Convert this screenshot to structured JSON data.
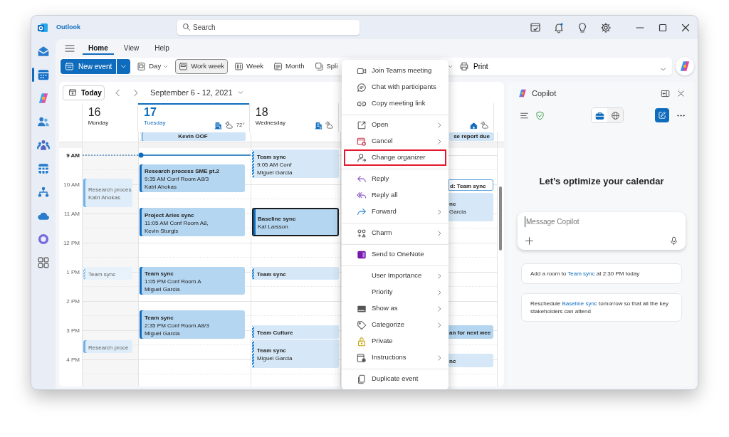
{
  "window": {
    "title": "Outlook"
  },
  "search": {
    "placeholder": "Search"
  },
  "rail": [
    {
      "selected": false
    },
    {
      "selected": true
    },
    {
      "selected": false
    },
    {
      "selected": false
    },
    {
      "selected": false
    },
    {
      "selected": false
    },
    {
      "selected": false
    },
    {
      "selected": false
    },
    {
      "selected": false
    },
    {
      "selected": false
    }
  ],
  "ribbon_tabs": [
    {
      "label": "Home",
      "selected": true
    },
    {
      "label": "View",
      "selected": false
    },
    {
      "label": "Help",
      "selected": false
    }
  ],
  "new_event": {
    "label": "New event"
  },
  "view_buttons": [
    {
      "label": "Day",
      "selected": false,
      "dropdown": true
    },
    {
      "label": "Work week",
      "selected": true,
      "dropdown": false
    },
    {
      "label": "Week",
      "selected": false,
      "dropdown": false
    },
    {
      "label": "Month",
      "selected": false,
      "dropdown": false
    },
    {
      "label": "Spli",
      "selected": false,
      "dropdown": false
    }
  ],
  "print": {
    "label": "Print"
  },
  "date_nav": {
    "today": "Today",
    "range": "September 6 - 12, 2021"
  },
  "time_labels": [
    {
      "label": "9 AM",
      "current": true
    },
    {
      "label": "10 AM",
      "current": false
    },
    {
      "label": "11 AM",
      "current": false
    },
    {
      "label": "12 PM",
      "current": false
    },
    {
      "label": "1 PM",
      "current": false
    },
    {
      "label": "2 PM",
      "current": false
    },
    {
      "label": "3 PM",
      "current": false
    },
    {
      "label": "4 PM",
      "current": false
    }
  ],
  "days": [
    {
      "number": "16",
      "weekday": "Monday",
      "today": false,
      "past": true,
      "events": [
        {
          "kind": "busy",
          "selected": false,
          "lines": [
            "Research proces",
            "Katri Ahokas"
          ]
        },
        {
          "kind": "tentative",
          "selected": false,
          "lines": [
            "Team sync"
          ]
        },
        {
          "kind": "busy",
          "selected": false,
          "lines": [
            "Research proce"
          ]
        }
      ]
    },
    {
      "number": "17",
      "weekday": "Tuesday",
      "today": true,
      "past": false,
      "remote": false,
      "temperature": "72°",
      "all_day": [
        {
          "kind": "oof",
          "title": "Kevin OOF"
        }
      ],
      "events": [
        {
          "kind": "busy",
          "selected": false,
          "lines": [
            "Research process SME pt.2",
            "9:35 AM Conf Room A8/3",
            "Katri Ahokas"
          ]
        },
        {
          "kind": "busy",
          "selected": false,
          "lines": [
            "Project Aries sync",
            "11:05 AM  Conf Room A8,",
            "Kevin Sturgis"
          ]
        },
        {
          "kind": "busy",
          "selected": false,
          "lines": [
            "Team sync",
            "1:05 PM Conf Room A",
            "Miguel Garcia"
          ]
        },
        {
          "kind": "busy",
          "selected": false,
          "lines": [
            "Team sync",
            "2:35 PM Conf Room A8/3",
            "Miguel Garcia"
          ]
        }
      ]
    },
    {
      "number": "18",
      "weekday": "Wednesday",
      "today": false,
      "past": false,
      "remote": false,
      "events": [
        {
          "kind": "tentative",
          "selected": false,
          "lines": [
            "Team sync",
            "9:05 AM Conf",
            "Miguel Garcia"
          ]
        },
        {
          "kind": "busy",
          "selected": true,
          "lines": [
            "Baseline sync",
            "Kat Larsson"
          ]
        },
        {
          "kind": "tentative",
          "selected": false,
          "lines": [
            "Team sync"
          ]
        },
        {
          "kind": "tentative",
          "selected": false,
          "lines": [
            "Team Culture"
          ]
        },
        {
          "kind": "tentative",
          "selected": false,
          "lines": [
            "Team sync",
            "Miguel Garcia"
          ]
        }
      ]
    },
    {
      "today": false,
      "past": false,
      "remote": true,
      "all_day": [
        {
          "kind": "busy",
          "title": "se report due"
        }
      ],
      "events": [
        {
          "kind": "draft",
          "selected": false,
          "lines": [
            "d: Team sync"
          ]
        },
        {
          "kind": "tentative",
          "selected": false,
          "lines": [
            "nc",
            "Garcia"
          ]
        },
        {
          "kind": "busy",
          "selected": false,
          "lines": [
            "an for next wee"
          ]
        },
        {
          "kind": "tentative",
          "selected": false,
          "lines": [
            "nc"
          ]
        }
      ]
    }
  ],
  "context_menu": {
    "items": [
      {
        "label": "Join Teams meeting",
        "submenu": false,
        "divider_before": false,
        "highlighted": false
      },
      {
        "label": "Chat with participants",
        "submenu": false,
        "divider_before": false,
        "highlighted": false
      },
      {
        "label": "Copy meeting link",
        "submenu": false,
        "divider_before": false,
        "highlighted": false
      },
      {
        "label": "Open",
        "submenu": true,
        "divider_before": true,
        "highlighted": false
      },
      {
        "label": "Cancel",
        "submenu": true,
        "divider_before": false,
        "highlighted": false
      },
      {
        "label": "Change organizer",
        "submenu": false,
        "divider_before": false,
        "highlighted": true
      },
      {
        "label": "Reply",
        "submenu": false,
        "divider_before": true,
        "highlighted": false
      },
      {
        "label": "Reply all",
        "submenu": false,
        "divider_before": false,
        "highlighted": false
      },
      {
        "label": "Forward",
        "submenu": true,
        "divider_before": false,
        "highlighted": false
      },
      {
        "label": "Charm",
        "submenu": true,
        "divider_before": true,
        "highlighted": false
      },
      {
        "label": "Send to OneNote",
        "submenu": false,
        "divider_before": true,
        "highlighted": false
      },
      {
        "label": "User Importance",
        "submenu": true,
        "divider_before": true,
        "highlighted": false
      },
      {
        "label": "Priority",
        "submenu": true,
        "divider_before": false,
        "highlighted": false
      },
      {
        "label": "Show as",
        "submenu": true,
        "divider_before": false,
        "highlighted": false
      },
      {
        "label": "Categorize",
        "submenu": true,
        "divider_before": false,
        "highlighted": false
      },
      {
        "label": "Private",
        "submenu": false,
        "divider_before": false,
        "highlighted": false
      },
      {
        "label": "Instructions",
        "submenu": true,
        "divider_before": false,
        "highlighted": false
      },
      {
        "label": "Duplicate event",
        "submenu": false,
        "divider_before": true,
        "highlighted": false
      }
    ]
  },
  "copilot": {
    "title": "Copilot",
    "mode_toggle": [
      {
        "selected": true
      },
      {
        "selected": false
      }
    ],
    "heading": "Let’s optimize your calendar",
    "input": {
      "placeholder": "Message Copilot"
    },
    "suggestions": [
      {
        "parts": [
          {
            "text": "Add a room to ",
            "link": false
          },
          {
            "text": "Team sync",
            "link": true
          },
          {
            "text": " at 2:30 PM today",
            "link": false
          }
        ]
      },
      {
        "parts": [
          {
            "text": "Reschedule ",
            "link": false
          },
          {
            "text": "Baseline sync",
            "link": true
          },
          {
            "text": " tomorrow so that all the key stakeholders can attend",
            "link": false
          }
        ]
      }
    ]
  }
}
